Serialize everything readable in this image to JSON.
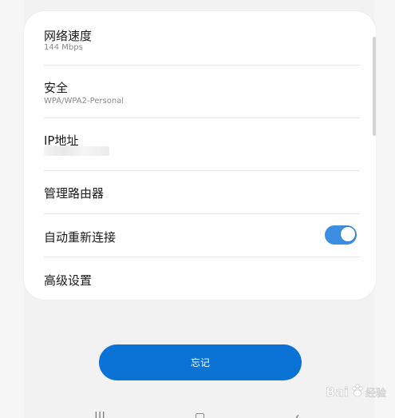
{
  "settings": {
    "rows": [
      {
        "title": "网络速度",
        "subtitle": "144 Mbps"
      },
      {
        "title": "安全",
        "subtitle": "WPA/WPA2-Personal"
      },
      {
        "title": "IP地址",
        "subtitle": ""
      },
      {
        "title": "管理路由器"
      },
      {
        "title": "自动重新连接",
        "toggle_on": true
      },
      {
        "title": "高级设置"
      }
    ]
  },
  "forget_button": {
    "label": "忘记"
  },
  "colors": {
    "accent": "#0b72d6",
    "toggle_on": "#3d8de0",
    "card_bg": "#ffffff",
    "page_bg": "#f2f2f2"
  },
  "watermark": {
    "text": "Bai 经验"
  },
  "nav_icons": [
    "recent-apps-icon",
    "home-icon",
    "back-icon"
  ]
}
